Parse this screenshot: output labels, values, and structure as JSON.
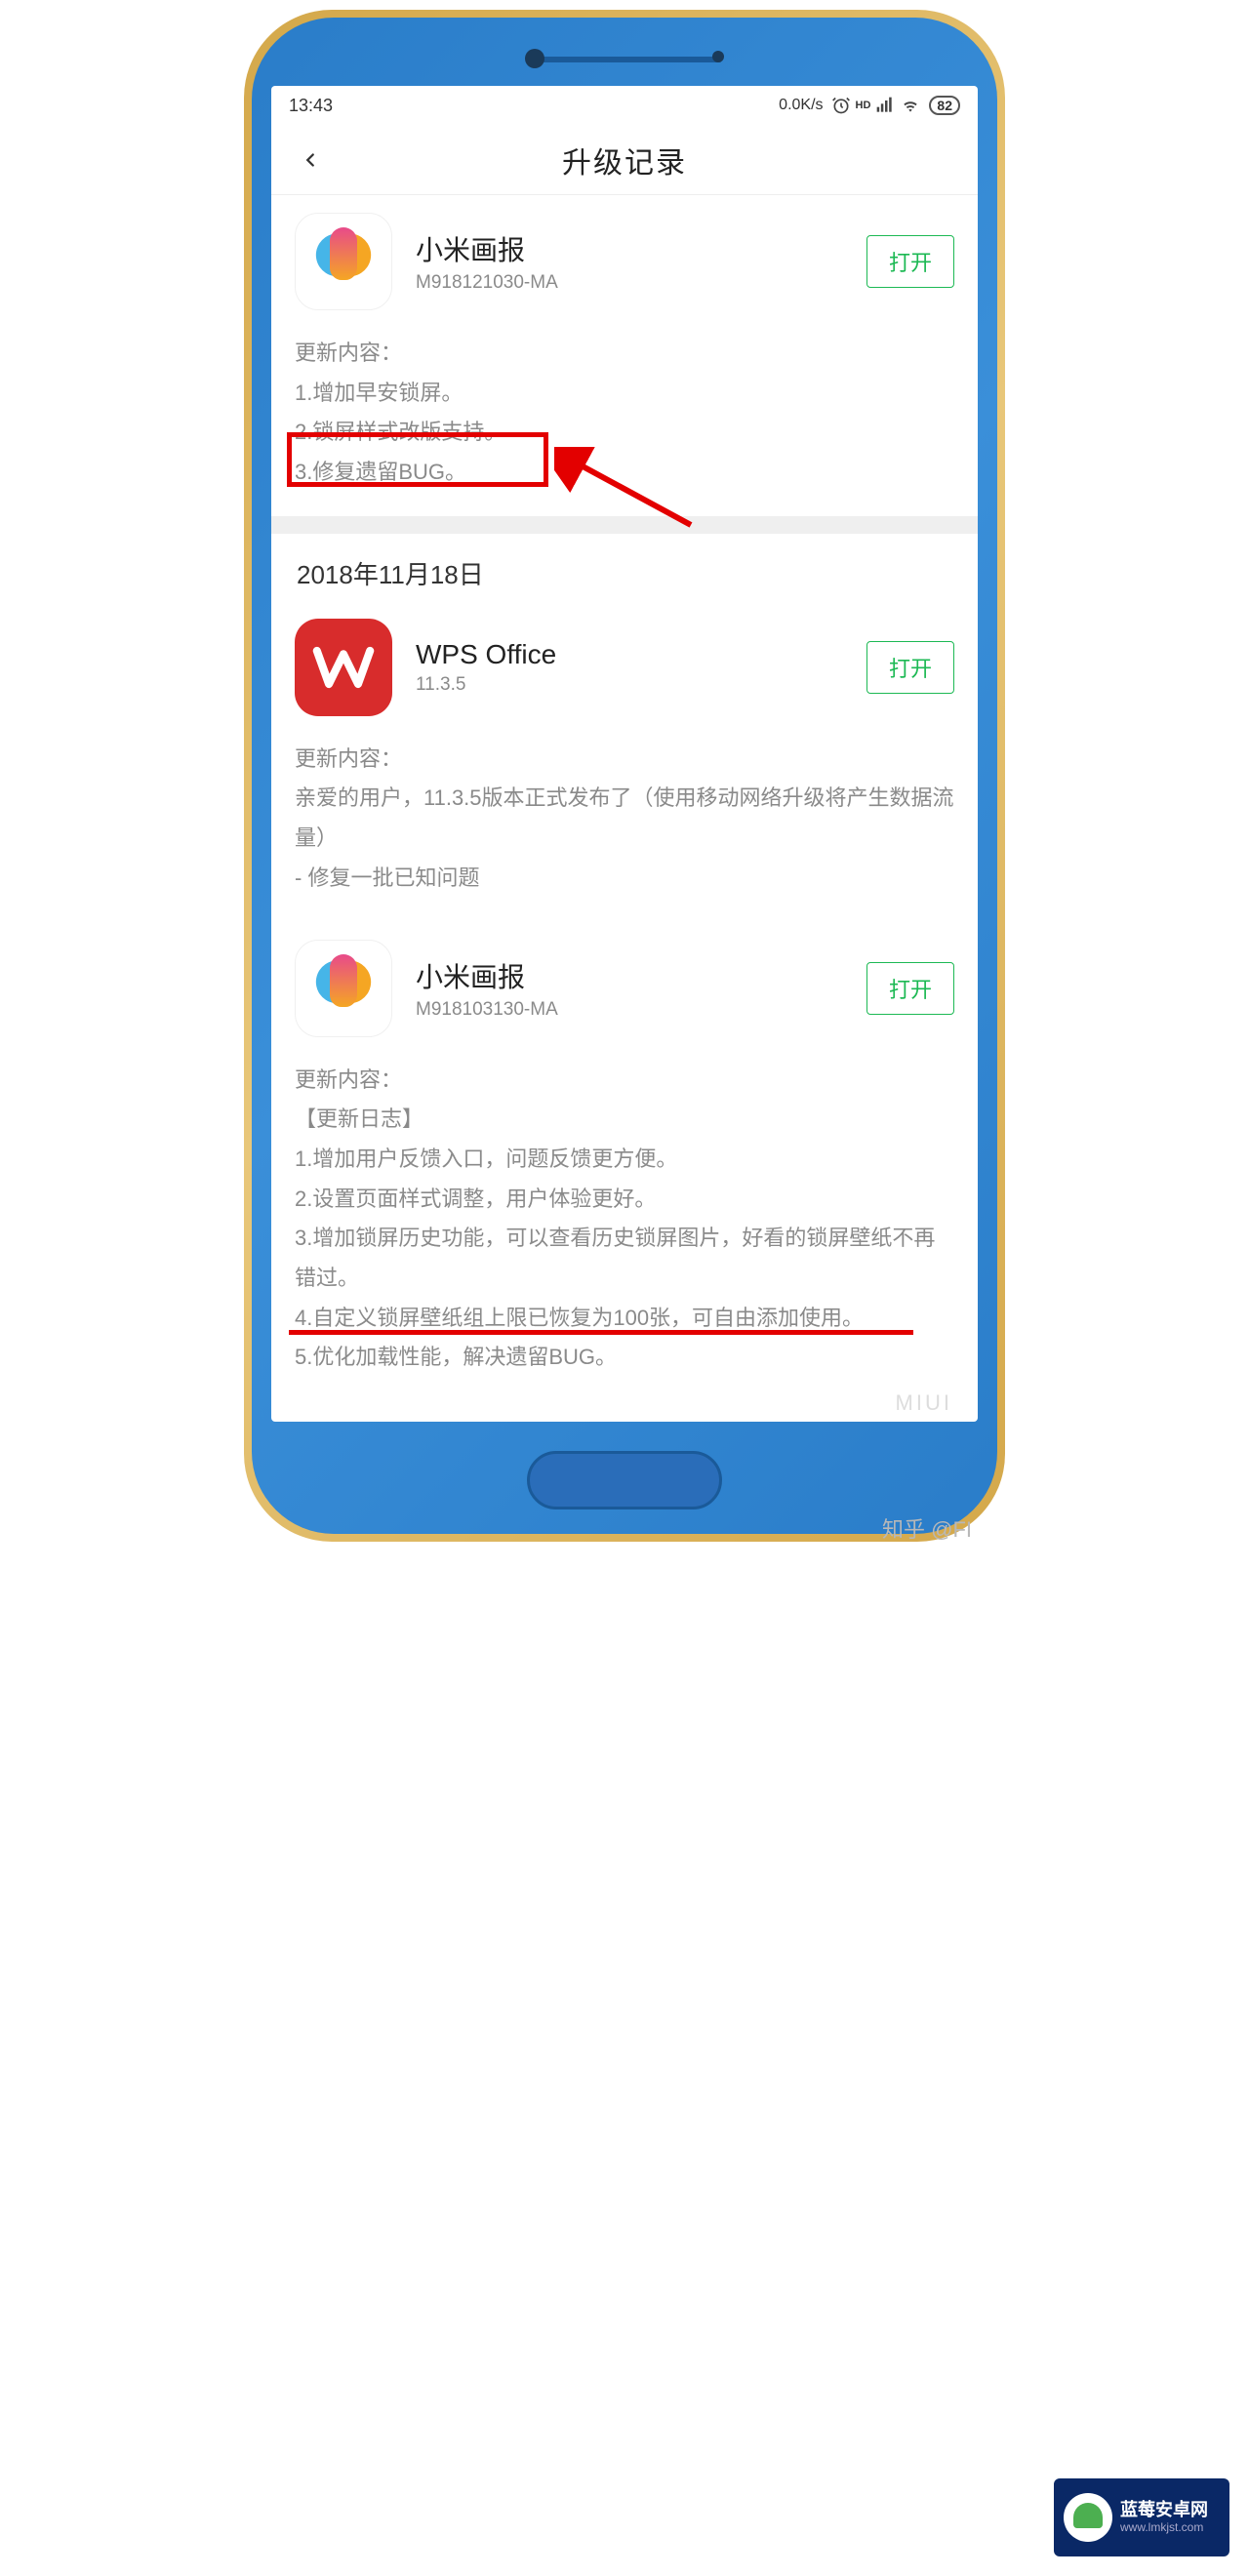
{
  "status_bar": {
    "time": "13:43",
    "net_speed": "0.0K/s",
    "hd_label": "HD",
    "battery": "82"
  },
  "nav": {
    "title": "升级记录"
  },
  "cards": [
    {
      "name": "小米画报",
      "version": "M918121030-MA",
      "action": "打开",
      "changelog_title": "更新内容：",
      "lines": [
        "1.增加早安锁屏。",
        "2.锁屏样式改版支持。",
        "3.修复遗留BUG。"
      ]
    },
    {
      "name": "WPS Office",
      "version": "11.3.5",
      "action": "打开",
      "changelog_title": "更新内容：",
      "lines": [
        "亲爱的用户，11.3.5版本正式发布了（使用移动网络升级将产生数据流量）",
        "- 修复一批已知问题"
      ]
    },
    {
      "name": "小米画报",
      "version": "M918103130-MA",
      "action": "打开",
      "changelog_title": "更新内容：",
      "subtitle": "【更新日志】",
      "lines": [
        "1.增加用户反馈入口，问题反馈更方便。",
        "2.设置页面样式调整，用户体验更好。",
        "3.增加锁屏历史功能，可以查看历史锁屏图片，好看的锁屏壁纸不再错过。",
        "4.自定义锁屏壁纸组上限已恢复为100张，可自由添加使用。",
        "5.优化加载性能，解决遗留BUG。"
      ]
    }
  ],
  "date_section": "2018年11月18日",
  "miui_mark": "MIUI",
  "zhihu_mark": "知乎 @FI",
  "logo": {
    "title": "蓝莓安卓网",
    "sub": "www.lmkjst.com"
  }
}
